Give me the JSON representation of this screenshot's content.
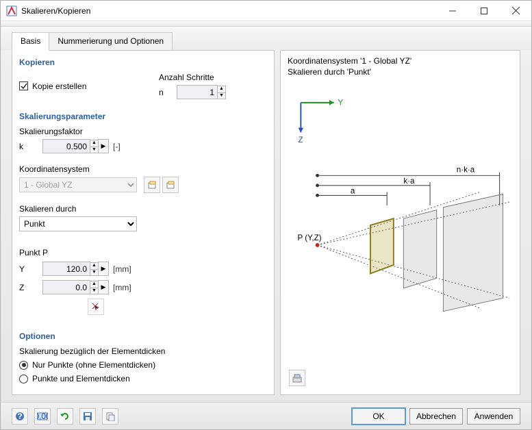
{
  "window": {
    "title": "Skalieren/Kopieren"
  },
  "tabs": {
    "basis": "Basis",
    "numbering": "Nummerierung und Optionen"
  },
  "copy": {
    "section": "Kopieren",
    "create_copy": "Kopie erstellen",
    "steps_label": "Anzahl Schritte",
    "n_label": "n",
    "n_value": "1"
  },
  "scaling": {
    "section": "Skalierungsparameter",
    "factor_label": "Skalierungsfaktor",
    "k_label": "k",
    "k_value": "0.500",
    "k_unit": "[-]",
    "coord_label": "Koordinatensystem",
    "coord_value": "1 - Global YZ",
    "scale_by_label": "Skalieren durch",
    "scale_by_value": "Punkt"
  },
  "pointP": {
    "section": "Punkt P",
    "y_label": "Y",
    "y_value": "120.0",
    "z_label": "Z",
    "z_value": "0.0",
    "unit": "[mm]"
  },
  "options": {
    "section": "Optionen",
    "subtitle": "Skalierung bezüglich der Elementdicken",
    "r1": "Nur Punkte (ohne Elementdicken)",
    "r2": "Punkte und Elementdicken"
  },
  "preview": {
    "line1": "Koordinatensystem '1 - Global YZ'",
    "line2": "Skalieren durch 'Punkt'",
    "axisY": "Y",
    "axisZ": "Z",
    "dimA": "a",
    "dimKA": "k·a",
    "dimNKA": "n·k·a",
    "pLabel": "P (Y,Z)"
  },
  "buttons": {
    "ok": "OK",
    "cancel": "Abbrechen",
    "apply": "Anwenden"
  },
  "icons": {
    "help": "help-icon",
    "decimal": "decimal-icon",
    "refresh": "refresh-icon",
    "save": "save-icon",
    "copy": "copy-icon"
  }
}
